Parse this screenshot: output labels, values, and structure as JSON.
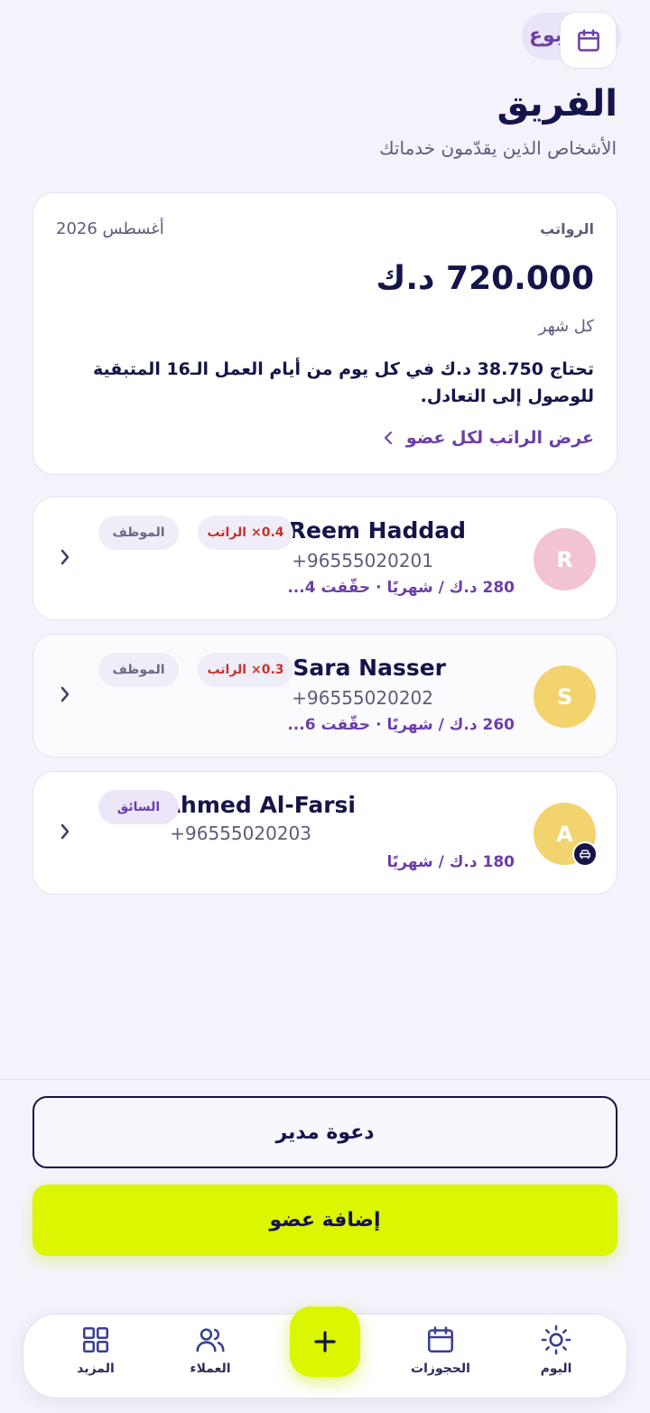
{
  "header": {
    "chip_label": "الأسبوع",
    "title": "الفريق",
    "subtitle": "الأشخاص الذين يقدّمون خدماتك"
  },
  "salary": {
    "label": "الرواتب",
    "month": "أغسطس 2026",
    "amount": "720.000 د.ك",
    "period": "كل شهر",
    "note": "تحتاج 38.750 د.ك في كل يوم من أيام العمل الـ16 المتبقية للوصول إلى التعادل.",
    "link": "عرض الراتب لكل عضو"
  },
  "members": [
    {
      "initial": "R",
      "name": "Reem Haddad",
      "phone": "+96555020201",
      "pay": "280 د.ك / شهريًا · حقّقت 4...",
      "multiplier": "0.4× الراتب",
      "role": "الموظف"
    },
    {
      "initial": "S",
      "name": "Sara Nasser",
      "phone": "+96555020202",
      "pay": "260 د.ك / شهريًا · حقّقت 6...",
      "multiplier": "0.3× الراتب",
      "role": "الموظف"
    },
    {
      "initial": "A",
      "name": "Ahmed Al-Farsi",
      "phone": "+96555020203",
      "pay": "180 د.ك / شهريًا",
      "role": "السائق"
    }
  ],
  "actions": {
    "invite_manager": "دعوة مدير",
    "add_member": "إضافة عضو"
  },
  "nav": {
    "today": "اليوم",
    "bookings": "الحجوزات",
    "clients": "العملاء",
    "more": "المزيد"
  },
  "colors": {
    "accent": "#dcf500",
    "brand_purple": "#6b3fa8",
    "navy": "#15144a"
  }
}
